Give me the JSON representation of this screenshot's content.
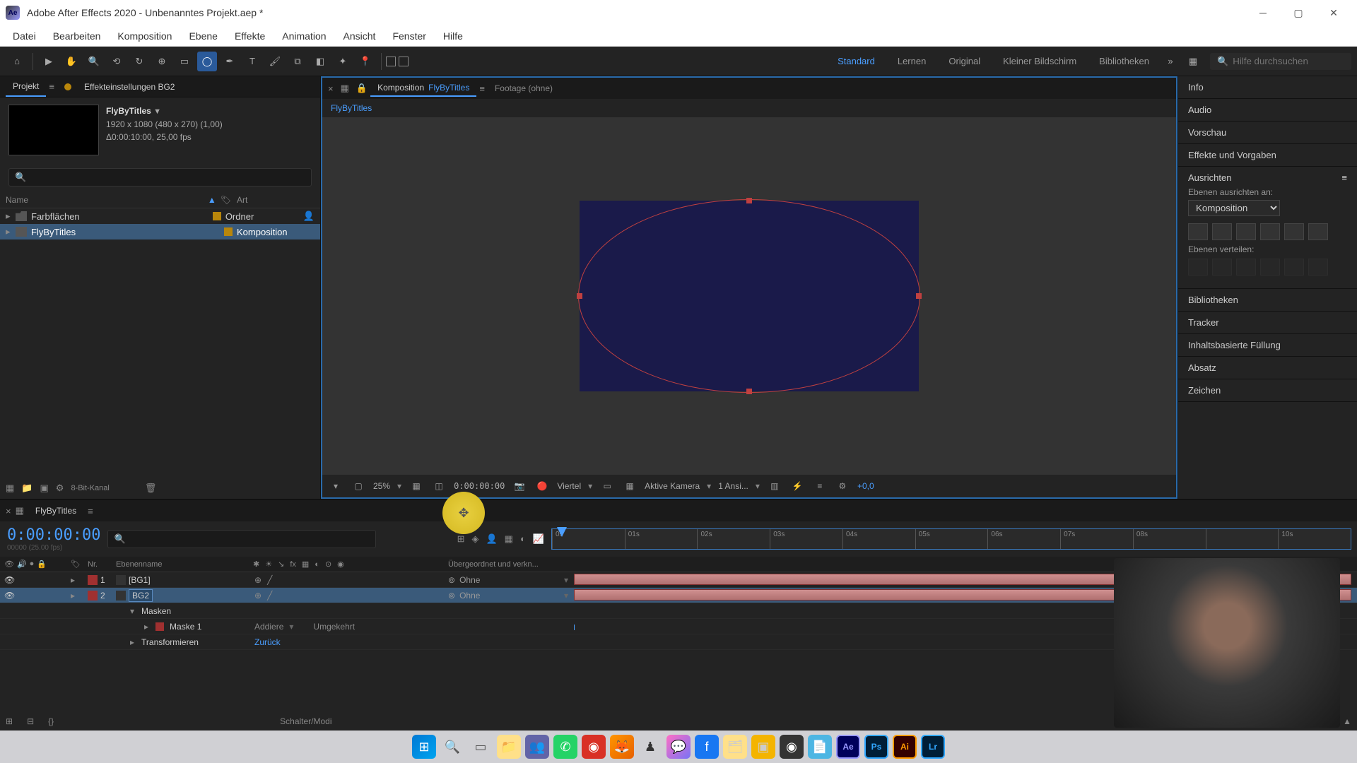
{
  "titlebar": {
    "title": "Adobe After Effects 2020 - Unbenanntes Projekt.aep *"
  },
  "menu": [
    "Datei",
    "Bearbeiten",
    "Komposition",
    "Ebene",
    "Effekte",
    "Animation",
    "Ansicht",
    "Fenster",
    "Hilfe"
  ],
  "workspaces": [
    "Standard",
    "Lernen",
    "Original",
    "Kleiner Bildschirm",
    "Bibliotheken"
  ],
  "workspace_active": "Standard",
  "search": {
    "placeholder": "Hilfe durchsuchen"
  },
  "project": {
    "tab": "Projekt",
    "effects_tab": "Effekteinstellungen  BG2",
    "thumb_name": "FlyByTitles",
    "thumb_line1": "1920 x 1080 (480 x 270) (1,00)",
    "thumb_line2": "Δ0:00:10:00, 25,00 fps",
    "col_name": "Name",
    "col_type": "Art",
    "rows": [
      {
        "name": "Farbflächen",
        "type": "Ordner",
        "kind": "folder"
      },
      {
        "name": "FlyByTitles",
        "type": "Komposition",
        "kind": "comp",
        "sel": true
      }
    ],
    "footer_bpc": "8-Bit-Kanal"
  },
  "comp": {
    "tab_label": "Komposition",
    "tab_name": "FlyByTitles",
    "tab2": "Footage  (ohne)",
    "breadcrumb": "FlyByTitles",
    "footer": {
      "zoom": "25%",
      "time": "0:00:00:00",
      "res": "Viertel",
      "camera": "Aktive Kamera",
      "views": "1 Ansi...",
      "exposure": "+0,0"
    }
  },
  "right": {
    "panels": [
      "Info",
      "Audio",
      "Vorschau",
      "Effekte und Vorgaben"
    ],
    "align": {
      "title": "Ausrichten",
      "lab1": "Ebenen ausrichten an:",
      "select": "Komposition",
      "lab2": "Ebenen verteilen:"
    },
    "panels2": [
      "Bibliotheken",
      "Tracker",
      "Inhaltsbasierte Füllung",
      "Absatz",
      "Zeichen"
    ]
  },
  "timeline": {
    "tab": "FlyByTitles",
    "timecode": "0:00:00:00",
    "timecode_sub": "00000 (25.00 fps)",
    "col_nr": "Nr.",
    "col_name": "Ebenenname",
    "col_parent": "Übergeordnet und verkn...",
    "ticks": [
      "0s",
      "01s",
      "02s",
      "03s",
      "04s",
      "05s",
      "06s",
      "07s",
      "08s",
      "",
      "10s"
    ],
    "layers": [
      {
        "nr": "1",
        "name": "[BG1]",
        "parent": "Ohne"
      },
      {
        "nr": "2",
        "name": "BG2",
        "parent": "Ohne",
        "sel": true
      }
    ],
    "masks_label": "Masken",
    "mask1": "Maske 1",
    "mask_mode": "Addiere",
    "mask_inv": "Umgekehrt",
    "transform": "Transformieren",
    "transform_reset": "Zurück",
    "footer_toggle": "Schalter/Modi"
  }
}
